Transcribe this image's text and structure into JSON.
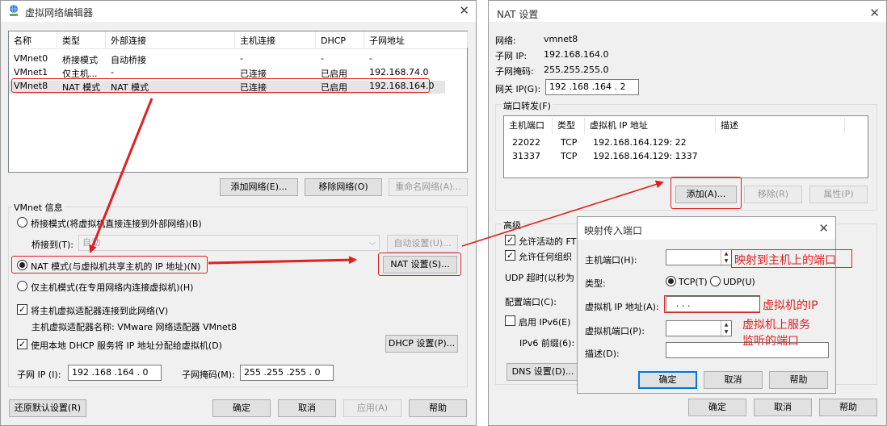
{
  "left": {
    "title": "虚拟网络编辑器",
    "table": {
      "headers": [
        "名称",
        "类型",
        "外部连接",
        "主机连接",
        "DHCP",
        "子网地址"
      ],
      "rows": [
        [
          "VMnet0",
          "桥接模式",
          "自动桥接",
          "-",
          "-",
          "-"
        ],
        [
          "VMnet1",
          "仅主机...",
          "-",
          "已连接",
          "已启用",
          "192.168.74.0"
        ],
        [
          "VMnet8",
          "NAT 模式",
          "NAT 模式",
          "已连接",
          "已启用",
          "192.168.164.0"
        ]
      ]
    },
    "add_network": "添加网络(E)...",
    "remove_network": "移除网络(O)",
    "rename_network": "重命名网络(A)...",
    "vmnet_info": "VMnet 信息",
    "bridge_mode": "桥接模式(将虚拟机直接连接到外部网络)(B)",
    "bridge_to_label": "桥接到(T):",
    "bridge_to_value": "自动",
    "auto_settings": "自动设置(U)...",
    "nat_mode": "NAT 模式(与虚拟机共享主机的 IP 地址)(N)",
    "nat_settings": "NAT 设置(S)...",
    "host_only": "仅主机模式(在专用网络内连接虚拟机)(H)",
    "connect_adapter": "将主机虚拟适配器连接到此网络(V)",
    "adapter_name": "主机虚拟适配器名称: VMware 网络适配器 VMnet8",
    "use_dhcp": "使用本地 DHCP 服务将 IP 地址分配给虚拟机(D)",
    "dhcp_settings": "DHCP 设置(P)...",
    "subnet_ip_label": "子网 IP (I):",
    "subnet_ip": "192 .168 .164 .  0",
    "subnet_mask_label": "子网掩码(M):",
    "subnet_mask": "255 .255 .255 .  0",
    "restore_defaults": "还原默认设置(R)",
    "ok": "确定",
    "cancel": "取消",
    "apply": "应用(A)",
    "help": "帮助"
  },
  "nat": {
    "title": "NAT 设置",
    "network_label": "网络:",
    "network": "vmnet8",
    "subnet_ip_label": "子网 IP:",
    "subnet_ip": "192.168.164.0",
    "subnet_mask_label": "子网掩码:",
    "subnet_mask": "255.255.255.0",
    "gateway_label": "网关 IP(G):",
    "gateway": "192 .168 .164 .  2",
    "port_forwarding": "端口转发(F)",
    "pf_headers": [
      "主机端口",
      "类型",
      "虚拟机 IP 地址",
      "描述"
    ],
    "pf_rows": [
      [
        "22022",
        "TCP",
        "192.168.164.129: 22",
        ""
      ],
      [
        "31337",
        "TCP",
        "192.168.164.129: 1337",
        ""
      ]
    ],
    "add": "添加(A)...",
    "remove": "移除(R)",
    "properties": "属性(P)",
    "advanced": "高级",
    "allow_active_ftp": "允许活动的 FT",
    "allow_any_oui": "允许任何组织",
    "udp_timeout": "UDP 超时(以秒为",
    "config_port": "配置端口(C):",
    "enable_ipv6": "启用 IPv6(E)",
    "ipv6_prefix": "IPv6 前缀(6):",
    "dns_settings": "DNS 设置(D)...",
    "ok": "确定",
    "cancel": "取消",
    "help": "帮助"
  },
  "map": {
    "title": "映射传入端口",
    "host_port_label": "主机端口(H):",
    "type_label": "类型:",
    "tcp": "TCP(T)",
    "udp": "UDP(U)",
    "vm_ip_label": "虚拟机 IP 地址(A):",
    "vm_ip_value": ".     .     .",
    "vm_port_label": "虚拟机端口(P):",
    "desc_label": "描述(D):",
    "ok": "确定",
    "cancel": "取消",
    "help": "帮助"
  },
  "annotations": {
    "host_port": "映射到主机上的端口",
    "vm_ip": "虚拟机的IP",
    "vm_port_line1": "虚拟机上服务",
    "vm_port_line2": "监听的端口"
  },
  "colors": {
    "annotation": "#e02020",
    "selection": "#e5e5e5",
    "focus": "#0078d7"
  }
}
